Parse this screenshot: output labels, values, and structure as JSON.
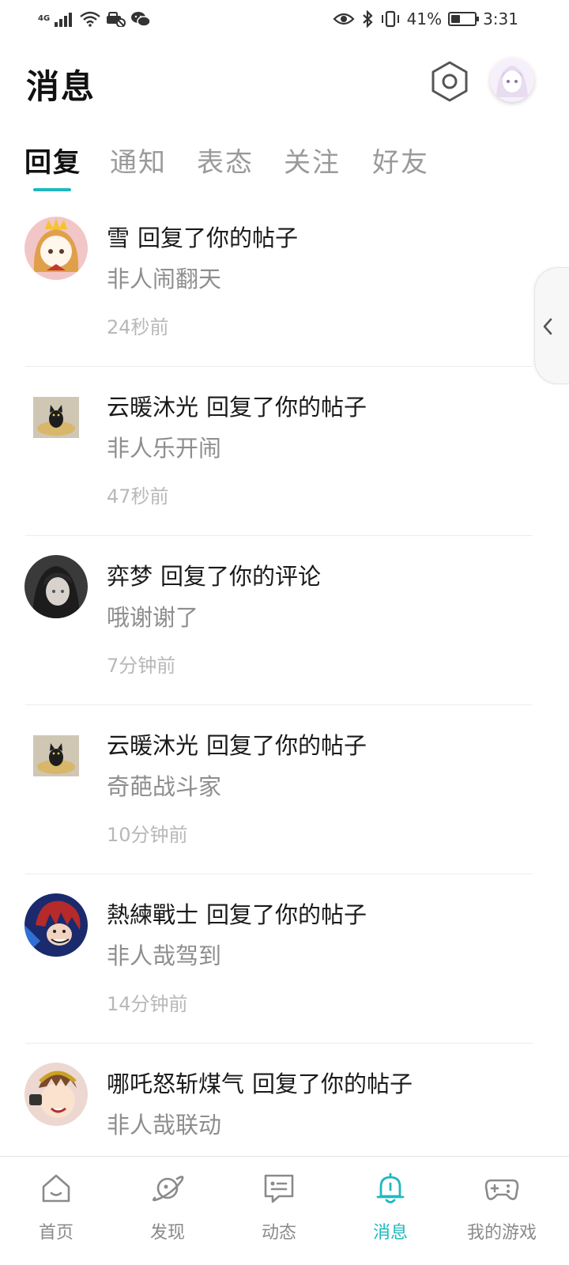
{
  "status_bar": {
    "network": "4G",
    "battery_percent_text": "41%",
    "battery_level": 0.41,
    "time": "3:31"
  },
  "header": {
    "title": "消息"
  },
  "tabs": [
    {
      "label": "回复",
      "active": true
    },
    {
      "label": "通知",
      "active": false
    },
    {
      "label": "表态",
      "active": false
    },
    {
      "label": "关注",
      "active": false
    },
    {
      "label": "好友",
      "active": false
    }
  ],
  "messages": [
    {
      "user": "雪",
      "action": "回复了你的帖子",
      "content": "非人闹翻天",
      "time": "24秒前",
      "avatar": "cartoon-girl-avatar"
    },
    {
      "user": "云暖沐光",
      "action": "回复了你的帖子",
      "content": "非人乐开闹",
      "time": "47秒前",
      "avatar": "black-cat-avatar"
    },
    {
      "user": "弈梦",
      "action": "回复了你的评论",
      "content": "哦谢谢了",
      "time": "7分钟前",
      "avatar": "dark-anime-avatar"
    },
    {
      "user": "云暖沐光",
      "action": "回复了你的帖子",
      "content": "奇葩战斗家",
      "time": "10分钟前",
      "avatar": "black-cat-avatar"
    },
    {
      "user": "熱練戰士",
      "action": "回复了你的帖子",
      "content": "非人哉驾到",
      "time": "14分钟前",
      "avatar": "red-hair-avatar"
    },
    {
      "user": "哪吒怒斩煤气",
      "action": "回复了你的帖子",
      "content": "非人哉联动",
      "time": "",
      "avatar": "laurel-avatar"
    }
  ],
  "bottom_nav": [
    {
      "label": "首页",
      "icon": "home-icon",
      "active": false
    },
    {
      "label": "发现",
      "icon": "planet-icon",
      "active": false
    },
    {
      "label": "动态",
      "icon": "chat-bubble-icon",
      "active": false
    },
    {
      "label": "消息",
      "icon": "bell-icon",
      "active": true
    },
    {
      "label": "我的游戏",
      "icon": "gamepad-icon",
      "active": false
    }
  ],
  "colors": {
    "accent": "#1fb8c0",
    "text_primary": "#1a1a1a",
    "text_secondary": "#8e8e8e",
    "text_time": "#b8b8b8"
  }
}
